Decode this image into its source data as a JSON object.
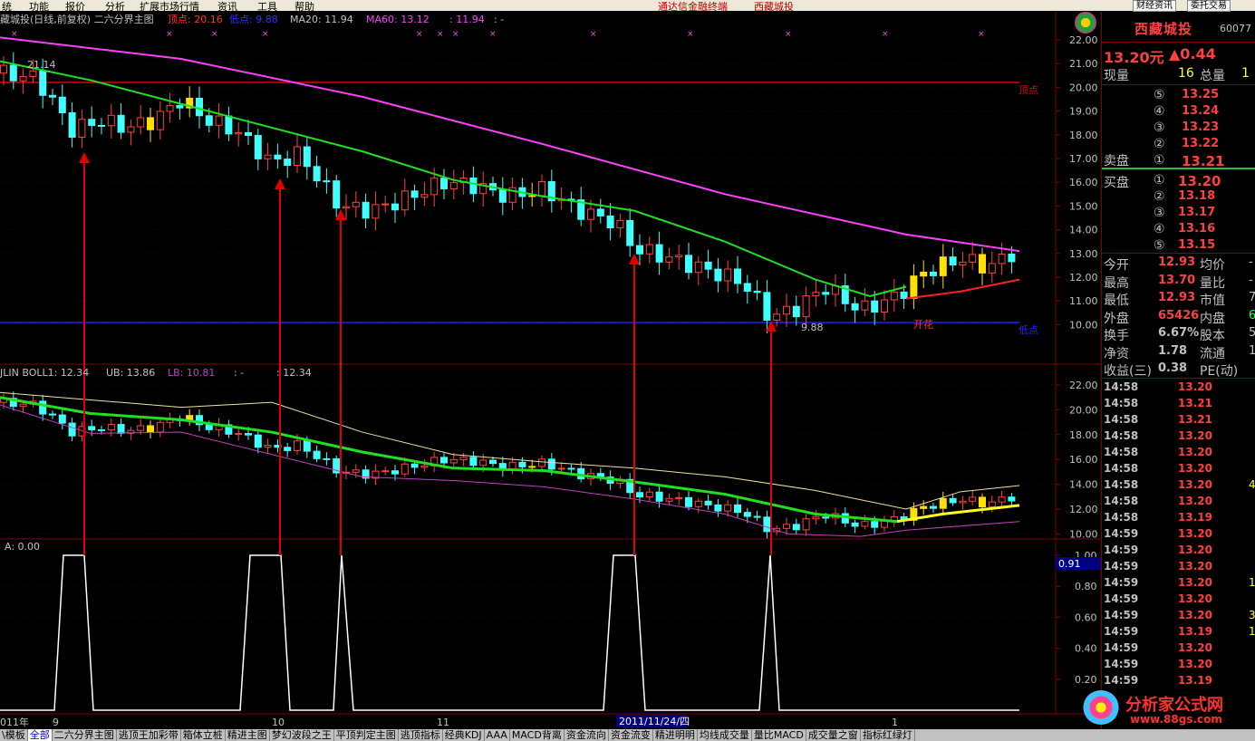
{
  "menu": {
    "items": [
      "统",
      "功能",
      "报价",
      "分析",
      "扩展市场行情",
      "资讯",
      "工具",
      "帮助"
    ],
    "promo_link1": "通达信金融终端",
    "promo_link2": "西藏城投",
    "btn_news": "财经资讯",
    "btn_trade": "委托交易"
  },
  "top_panel": {
    "title": "藏城投(日线,前复权) 二六分界主图",
    "ind_top": "顶点: 20.16",
    "ind_bottom": "低点: 9.88",
    "ma20": "MA20: 11.94",
    "ma60": "MA60: 13.12",
    "extra": ": 11.94",
    "extra2": ": -",
    "peak_label": "顶点",
    "low_label": "低点",
    "annot_high": "21.14",
    "annot_low": "9.88",
    "kaihua": "开花",
    "y_ticks": [
      "22.00",
      "21.00",
      "20.00",
      "19.00",
      "18.00",
      "17.00",
      "16.00",
      "15.00",
      "14.00",
      "13.00",
      "12.00",
      "11.00",
      "10.00"
    ]
  },
  "mid_panel": {
    "title": "JLIN BOLL1: 12.34",
    "ub": "UB: 13.86",
    "lb": "LB: 10.81",
    "extra": ": -",
    "extra2": ": 12.34",
    "y_ticks": [
      "22.00",
      "20.00",
      "18.00",
      "16.00",
      "14.00",
      "12.00",
      "10.00"
    ]
  },
  "bottom_panel": {
    "title": "A: 0.00",
    "current_value": "0.91",
    "y_ticks": [
      "1.00",
      "0.80",
      "0.60",
      "0.40",
      "0.20"
    ]
  },
  "x_axis": {
    "labels": [
      "011年",
      "9",
      "10",
      "11",
      "1"
    ],
    "cursor_date": "2011/11/24/四"
  },
  "quote": {
    "name": "西藏城投",
    "code": "60077",
    "price": "13.20元",
    "change": "▲0.44",
    "vol_now_label": "现量",
    "vol_now": "16",
    "vol_total_label": "总量",
    "vol_total": "1",
    "sell_label": "卖盘",
    "buy_label": "买盘",
    "asks": [
      {
        "lvl": "⑤",
        "price": "13.25"
      },
      {
        "lvl": "④",
        "price": "13.24"
      },
      {
        "lvl": "③",
        "price": "13.23"
      },
      {
        "lvl": "②",
        "price": "13.22"
      },
      {
        "lvl": "①",
        "price": "13.21"
      }
    ],
    "bids": [
      {
        "lvl": "①",
        "price": "13.20"
      },
      {
        "lvl": "②",
        "price": "13.18"
      },
      {
        "lvl": "③",
        "price": "13.17"
      },
      {
        "lvl": "④",
        "price": "13.16"
      },
      {
        "lvl": "⑤",
        "price": "13.15"
      }
    ],
    "stats": [
      {
        "l1": "今开",
        "v1": "12.93",
        "l2": "均价",
        "v2": "-"
      },
      {
        "l1": "最高",
        "v1": "13.70",
        "l2": "量比",
        "v2": "-"
      },
      {
        "l1": "最低",
        "v1": "12.93",
        "l2": "市值",
        "v2": "7"
      },
      {
        "l1": "外盘",
        "v1": "65426",
        "l2": "内盘",
        "v2": "6"
      },
      {
        "l1": "换手",
        "v1": "6.67%",
        "l2": "股本",
        "v2": "5"
      },
      {
        "l1": "净资",
        "v1": "1.78",
        "l2": "流通",
        "v2": "1"
      },
      {
        "l1": "收益(三)",
        "v1": "0.38",
        "l2": "PE(动)",
        "v2": ""
      }
    ],
    "ticks": [
      {
        "t": "14:58",
        "p": "13.20",
        "v": ""
      },
      {
        "t": "14:58",
        "p": "13.21",
        "v": ""
      },
      {
        "t": "14:58",
        "p": "13.21",
        "v": ""
      },
      {
        "t": "14:58",
        "p": "13.20",
        "v": ""
      },
      {
        "t": "14:58",
        "p": "13.20",
        "v": ""
      },
      {
        "t": "14:58",
        "p": "13.20",
        "v": ""
      },
      {
        "t": "14:58",
        "p": "13.20",
        "v": "4"
      },
      {
        "t": "14:58",
        "p": "13.20",
        "v": ""
      },
      {
        "t": "14:58",
        "p": "13.19",
        "v": ""
      },
      {
        "t": "14:59",
        "p": "13.20",
        "v": ""
      },
      {
        "t": "14:59",
        "p": "13.20",
        "v": ""
      },
      {
        "t": "14:59",
        "p": "13.20",
        "v": ""
      },
      {
        "t": "14:59",
        "p": "13.20",
        "v": "1"
      },
      {
        "t": "14:59",
        "p": "13.20",
        "v": ""
      },
      {
        "t": "14:59",
        "p": "13.20",
        "v": "3"
      },
      {
        "t": "14:59",
        "p": "13.19",
        "v": "1"
      },
      {
        "t": "14:59",
        "p": "13.20",
        "v": ""
      },
      {
        "t": "14:59",
        "p": "13.20",
        "v": ""
      },
      {
        "t": "14:59",
        "p": "13.19",
        "v": ""
      }
    ]
  },
  "tabs": [
    "\\模板",
    "全部",
    "二六分界主图",
    "逃顶王加彩带",
    "箱体立桩",
    "精进主图",
    "梦幻波段之王",
    "平顶判定主图",
    "逃顶指标",
    "经典KDJ",
    "AAA",
    "MACD背离",
    "资金流向",
    "资金流变",
    "精进明明",
    "均线成交量",
    "量比MACD",
    "成交量之窗",
    "指标红绿灯"
  ],
  "watermark": {
    "name": "分析家公式网",
    "url": "www.88gs.com"
  },
  "colors": {
    "up": "#ff4040",
    "down": "#40ffff",
    "ma20": "#20e020",
    "ma60": "#ff40ff",
    "peak_line": "#e00000",
    "low_line": "#2020ff",
    "arrow": "#e00000"
  }
}
